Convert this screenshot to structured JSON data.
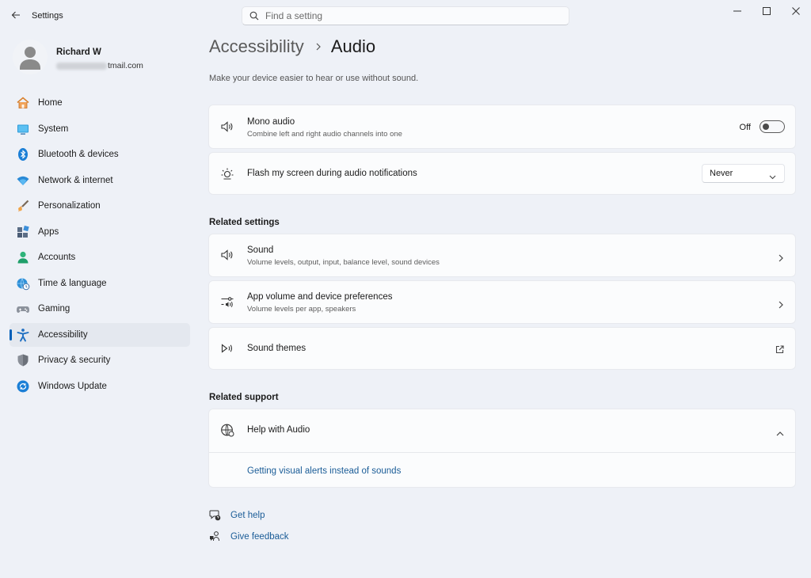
{
  "window": {
    "app_title": "Settings",
    "search_placeholder": "Find a setting"
  },
  "profile": {
    "name": "Richard W",
    "email_visible": "tmail.com"
  },
  "sidebar": {
    "items": [
      {
        "label": "Home",
        "icon": "home-icon"
      },
      {
        "label": "System",
        "icon": "system-icon"
      },
      {
        "label": "Bluetooth & devices",
        "icon": "bluetooth-icon"
      },
      {
        "label": "Network & internet",
        "icon": "wifi-icon"
      },
      {
        "label": "Personalization",
        "icon": "brush-icon"
      },
      {
        "label": "Apps",
        "icon": "apps-icon"
      },
      {
        "label": "Accounts",
        "icon": "accounts-icon"
      },
      {
        "label": "Time & language",
        "icon": "globe-clock-icon"
      },
      {
        "label": "Gaming",
        "icon": "gamepad-icon"
      },
      {
        "label": "Accessibility",
        "icon": "accessibility-icon",
        "active": true
      },
      {
        "label": "Privacy & security",
        "icon": "shield-icon"
      },
      {
        "label": "Windows Update",
        "icon": "update-icon"
      }
    ]
  },
  "page": {
    "breadcrumb_parent": "Accessibility",
    "breadcrumb_current": "Audio",
    "subtitle": "Make your device easier to hear or use without sound."
  },
  "settings": {
    "mono_audio": {
      "title": "Mono audio",
      "desc": "Combine left and right audio channels into one",
      "state_label": "Off"
    },
    "flash_screen": {
      "title": "Flash my screen during audio notifications",
      "value": "Never"
    }
  },
  "related_settings": {
    "heading": "Related settings",
    "items": [
      {
        "title": "Sound",
        "desc": "Volume levels, output, input, balance level, sound devices"
      },
      {
        "title": "App volume and device preferences",
        "desc": "Volume levels per app, speakers"
      },
      {
        "title": "Sound themes",
        "desc": ""
      }
    ]
  },
  "related_support": {
    "heading": "Related support",
    "help_title": "Help with Audio",
    "help_link": "Getting visual alerts instead of sounds"
  },
  "footer": {
    "get_help": "Get help",
    "give_feedback": "Give feedback"
  },
  "colors": {
    "accent": "#005fb8",
    "link": "#1a5c97",
    "background": "#eef1f7",
    "card": "#fbfcfd"
  }
}
